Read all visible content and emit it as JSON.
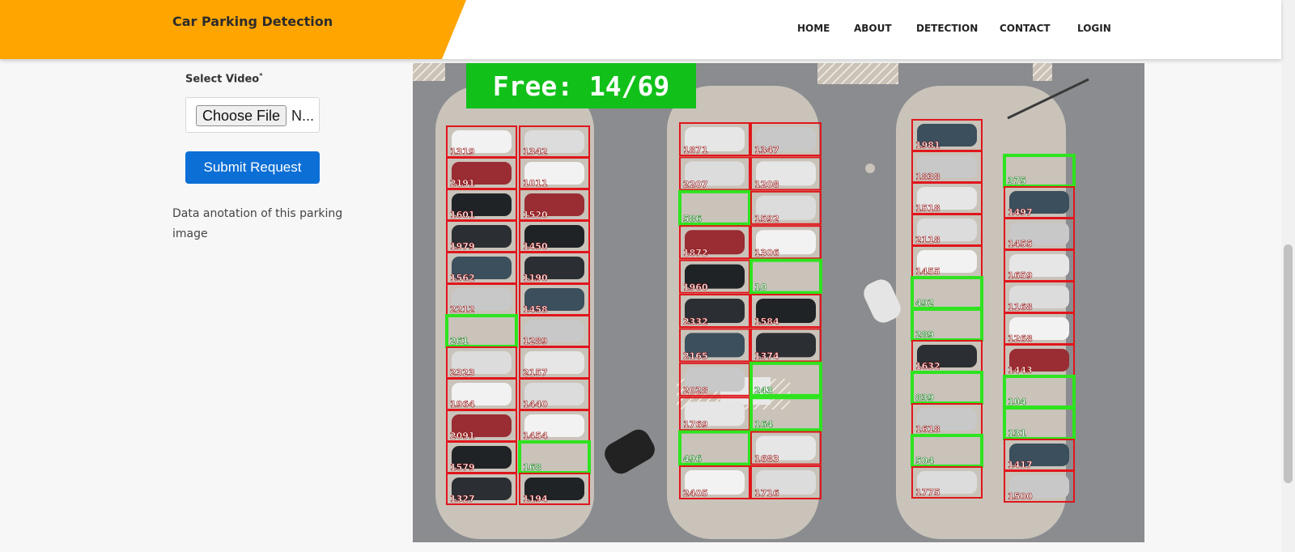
{
  "header": {
    "brand": "Car Parking Detection",
    "nav": [
      "HOME",
      "ABOUT",
      "DETECTION",
      "CONTACT",
      "LOGIN"
    ]
  },
  "form": {
    "select_label": "Select Video",
    "required_mark": "*",
    "file_button": "Choose File",
    "file_name": "N...",
    "submit_label": "Submit Request"
  },
  "description": "Data anotation of this parking image",
  "image": {
    "free_counter": "Free: 14/69",
    "colors": {
      "occupied": "#e0161b",
      "free": "#2ee31f",
      "counter_bg": "#11c11a"
    },
    "columns": [
      {
        "label": "left-outer",
        "spots": [
          [
            "1319",
            "occupied"
          ],
          [
            "2191",
            "occupied"
          ],
          [
            "1601",
            "occupied"
          ],
          [
            "1979",
            "occupied"
          ],
          [
            "1562",
            "occupied"
          ],
          [
            "2212",
            "occupied"
          ],
          [
            "261",
            "free"
          ],
          [
            "2323",
            "occupied"
          ],
          [
            "1964",
            "occupied"
          ],
          [
            "2091",
            "occupied"
          ],
          [
            "1579",
            "occupied"
          ],
          [
            "1327",
            "occupied"
          ]
        ]
      },
      {
        "label": "left-inner",
        "spots": [
          [
            "1342",
            "occupied"
          ],
          [
            "1011",
            "occupied"
          ],
          [
            "1520",
            "occupied"
          ],
          [
            "1450",
            "occupied"
          ],
          [
            "1190",
            "occupied"
          ],
          [
            "1458",
            "occupied"
          ],
          [
            "1289",
            "occupied"
          ],
          [
            "2157",
            "occupied"
          ],
          [
            "1440",
            "occupied"
          ],
          [
            "1454",
            "occupied"
          ],
          [
            "168",
            "free"
          ],
          [
            "1194",
            "occupied"
          ]
        ]
      },
      {
        "label": "mid-outer",
        "spots": [
          [
            "1871",
            "occupied"
          ],
          [
            "2207",
            "occupied"
          ],
          [
            "586",
            "free"
          ],
          [
            "1872",
            "occupied"
          ],
          [
            "1960",
            "occupied"
          ],
          [
            "2332",
            "occupied"
          ],
          [
            "2165",
            "occupied"
          ],
          [
            "2028",
            "occupied"
          ],
          [
            "1769",
            "occupied"
          ],
          [
            "496",
            "free"
          ],
          [
            "2405",
            "occupied"
          ]
        ]
      },
      {
        "label": "mid-inner",
        "spots": [
          [
            "1347",
            "occupied"
          ],
          [
            "1208",
            "occupied"
          ],
          [
            "1592",
            "occupied"
          ],
          [
            "1306",
            "occupied"
          ],
          [
            "10",
            "free"
          ],
          [
            "1584",
            "occupied"
          ],
          [
            "1374",
            "occupied"
          ],
          [
            "243",
            "free"
          ],
          [
            "164",
            "free"
          ],
          [
            "1683",
            "occupied"
          ],
          [
            "1716",
            "occupied"
          ]
        ]
      },
      {
        "label": "right-outer",
        "spots": [
          [
            "1981",
            "occupied"
          ],
          [
            "1838",
            "occupied"
          ],
          [
            "1518",
            "occupied"
          ],
          [
            "2118",
            "occupied"
          ],
          [
            "1455",
            "occupied"
          ],
          [
            "492",
            "free"
          ],
          [
            "289",
            "free"
          ],
          [
            "1632",
            "occupied"
          ],
          [
            "839",
            "free"
          ],
          [
            "1618",
            "occupied"
          ],
          [
            "504",
            "free"
          ],
          [
            "1775",
            "occupied"
          ]
        ]
      },
      {
        "label": "right-inner",
        "spots": [
          [
            "375",
            "free"
          ],
          [
            "1497",
            "occupied"
          ],
          [
            "1455",
            "occupied"
          ],
          [
            "1659",
            "occupied"
          ],
          [
            "1168",
            "occupied"
          ],
          [
            "1268",
            "occupied"
          ],
          [
            "1443",
            "occupied"
          ],
          [
            "104",
            "free"
          ],
          [
            "131",
            "free"
          ],
          [
            "1417",
            "occupied"
          ],
          [
            "1500",
            "occupied"
          ]
        ]
      }
    ]
  }
}
